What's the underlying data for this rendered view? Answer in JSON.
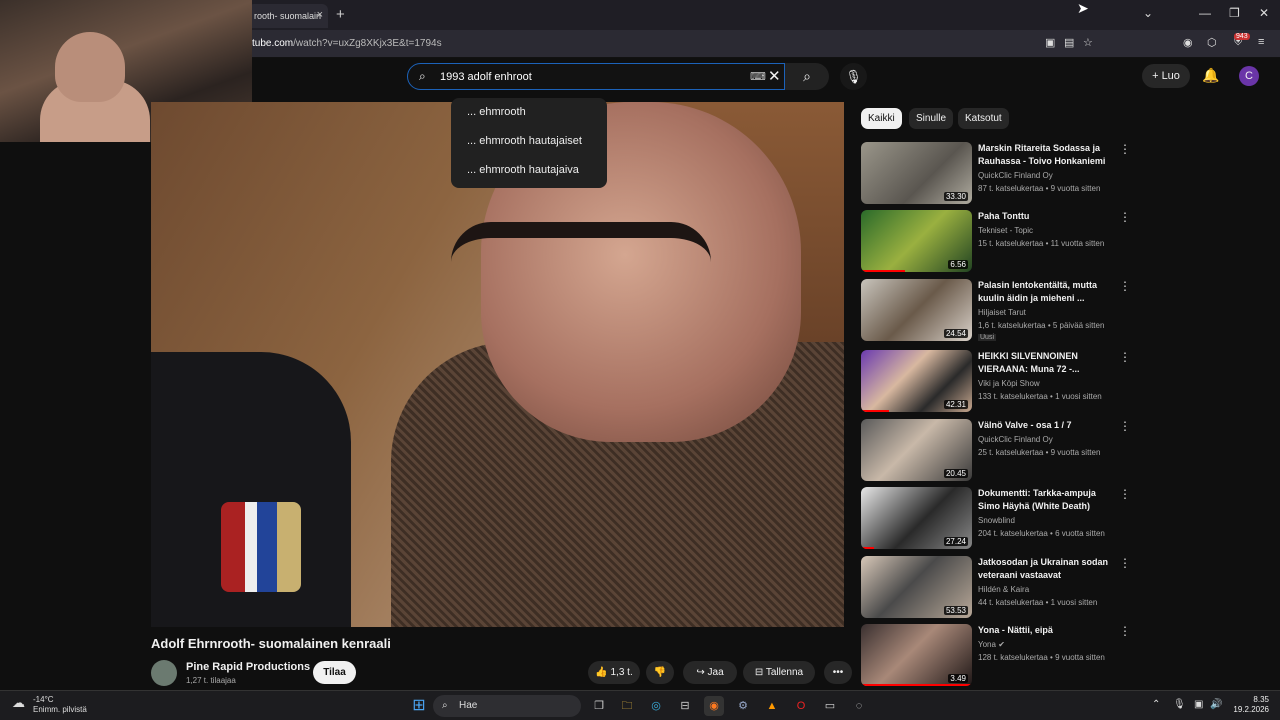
{
  "browser": {
    "tab_title": "rooth- suomalain",
    "tab_close": "×",
    "new_tab": "+",
    "url_prefix": "tube.com",
    "url_rest": "/watch?v=uxZg8XKjx3E&t=1794s",
    "extension_badge": "943",
    "window_min": "—",
    "window_max": "❐",
    "window_close": "✕",
    "tab_list": "⌄"
  },
  "header": {
    "search_value": "1993 adolf enhroot",
    "create_label": "Luo",
    "avatar_letter": "C",
    "search_icon": "search-icon",
    "accent": "#1c62b9"
  },
  "suggestions": [
    "... ehmrooth",
    "... ehmrooth hautajaiset",
    "... ehmrooth hautajaiva"
  ],
  "video": {
    "title": "Adolf Ehrnrooth- suomalainen kenraali",
    "channel": "Pine Rapid Productions",
    "subscribers": "1,27 t. tilaajaa",
    "subscribe_label": "Tilaa",
    "likes": "1,3 t.",
    "share_label": "Jaa",
    "save_label": "Tallenna",
    "more": "•••"
  },
  "chips": [
    {
      "label": "Kaikki",
      "active": true
    },
    {
      "label": "Sinulle",
      "active": false
    },
    {
      "label": "Katsotut",
      "active": false
    }
  ],
  "recommendations": [
    {
      "title": "Marskin Ritareita Sodassa ja Rauhassa - Toivo Honkaniemi",
      "channel": "QuickClic Finland Oy",
      "meta": "87 t. katselukertaa • 9 vuotta sitten",
      "duration": "33.30",
      "new": ""
    },
    {
      "title": "Paha Tonttu",
      "channel": "Tekniset - Topic",
      "meta": "15 t. katselukertaa • 11 vuotta sitten",
      "duration": "6.56",
      "new": ""
    },
    {
      "title": "Palasin lentokentältä, mutta kuulin äidin ja mieheni ...",
      "channel": "Hiljaiset Tarut",
      "meta": "1,6 t. katselukertaa • 5 päivää sitten",
      "duration": "24.54",
      "new": "Uusi"
    },
    {
      "title": "HEIKKI SILVENNOINEN VIERAANA: Muna 72 -...",
      "channel": "Viki ja Köpi Show",
      "meta": "133 t. katselukertaa • 1 vuosi sitten",
      "duration": "42.31",
      "new": ""
    },
    {
      "title": "Välnö Valve - osa 1 / 7",
      "channel": "QuickClic Finland Oy",
      "meta": "25 t. katselukertaa • 9 vuotta sitten",
      "duration": "20.45",
      "new": ""
    },
    {
      "title": "Dokumentti: Tarkka-ampuja Simo Häyhä (White Death)",
      "channel": "Snowblind",
      "meta": "204 t. katselukertaa • 6 vuotta sitten",
      "duration": "27.24",
      "new": ""
    },
    {
      "title": "Jatkosodan ja Ukrainan sodan veteraani vastaavat kysymyksi...",
      "channel": "Hildén & Kaira",
      "meta": "44 t. katselukertaa • 1 vuosi sitten",
      "duration": "53.53",
      "new": ""
    },
    {
      "title": "Yona - Nättii, eipä",
      "channel": "Yona",
      "meta": "128 t. katselukertaa • 9 vuotta sitten",
      "duration": "3.49",
      "new": ""
    }
  ],
  "taskbar": {
    "temp": "-14°C",
    "weather": "Enimm. pilvistä",
    "search_label": "Hae",
    "time": "8.35",
    "date": "19.2.2026"
  }
}
